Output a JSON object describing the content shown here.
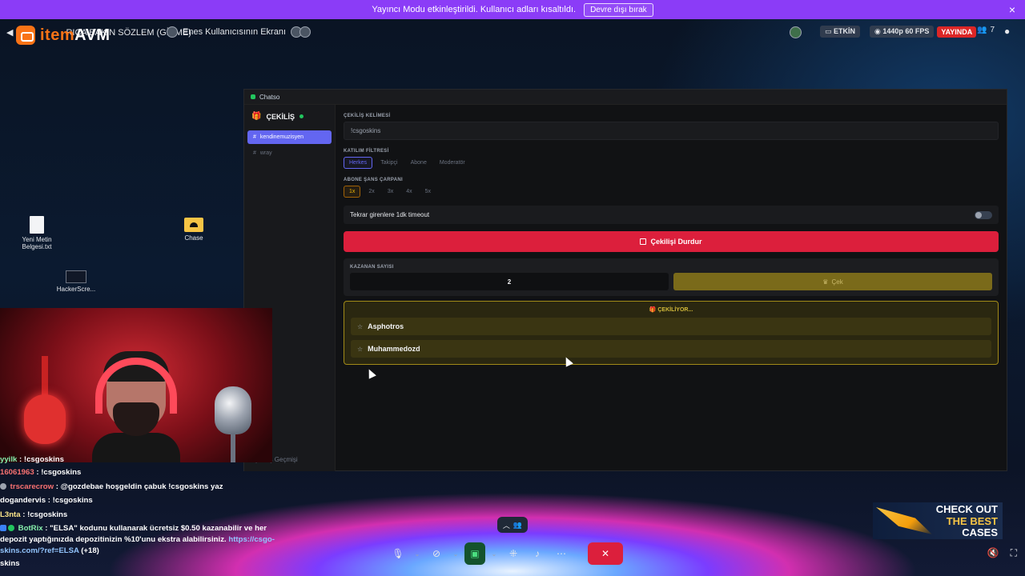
{
  "banner": {
    "text": "Yayıncı Modu etkinleştirildi. Kullanıcı adları kısaltıldı.",
    "disable_label": "Devre dışı bırak",
    "close_glyph": "×"
  },
  "overlay": {
    "logo_part1": "item",
    "logo_part2": "AVM",
    "share1_label": "RICA BAKIN SÖZLEM (GİRME)",
    "share2_label": "Enes Kullanıcısının Ekranı",
    "status_active": "ETKİN",
    "status_quality": "1440p 60 FPS",
    "status_live": "YAYINDA",
    "viewer_count": "7"
  },
  "desktop": {
    "icons": [
      {
        "name": "Yeni Metin Belgesi.txt"
      },
      {
        "name": "Chase"
      },
      {
        "name": "HackerScre..."
      }
    ]
  },
  "app": {
    "window_title": "Chatso",
    "sidebar": {
      "title": "ÇEKİLİŞ",
      "items": [
        "kendinemuzisyen",
        "wray"
      ],
      "footer": "Çekiliş Geçmişi"
    },
    "giveaway": {
      "keyword_label": "ÇEKİLİŞ KELİMESİ",
      "keyword_value": "!csgoskins",
      "filter_label": "KATILIM FİLTRESİ",
      "filters": [
        "Herkes",
        "Takipçi",
        "Abone",
        "Moderatör"
      ],
      "multiplier_label": "ABONE ŞANS ÇARPANI",
      "multipliers": [
        "1x",
        "2x",
        "3x",
        "4x",
        "5x"
      ],
      "timeout_label": "Tekrar girenlere 1dk timeout",
      "timeout_enabled": false,
      "stop_label": "Çekilişi Durdur",
      "winner_count_label": "KAZANAN SAYISI",
      "winner_count": "2",
      "draw_label": "Çek",
      "drawing_label": "ÇEKİLİYOR...",
      "entrants": [
        "Asphotros",
        "Muhammedozd"
      ]
    }
  },
  "chat": {
    "messages": [
      {
        "user": "yyilk",
        "text": "!csgoskins",
        "color": "#86efac"
      },
      {
        "user": "16061963",
        "text": "!csgoskins",
        "color": "#f87171"
      },
      {
        "user": "trscarecrow",
        "text": "@gozdebae hoşgeldin çabuk !csgoskins yaz",
        "color": "#f87171"
      },
      {
        "user": "dogandervis",
        "text": "!csgoskins",
        "color": "#ffffff"
      },
      {
        "user": "L3nta",
        "text": "!csgoskins",
        "color": "#fde68a"
      }
    ],
    "bot": {
      "user": "BotRix",
      "text": "\"ELSA\" kodunu kullanarak ücretsiz $0.50 kazanabilir ve her depozit yaptığınızda depozitinizin %10'unu ekstra alabilirsiniz.",
      "link": "https://csgo-skins.com/?ref=ELSA",
      "extra": "(+18)"
    },
    "last": "skins"
  },
  "ad": {
    "line1": "CHECK OUT",
    "line2": "THE BEST",
    "line3": "CASES"
  }
}
